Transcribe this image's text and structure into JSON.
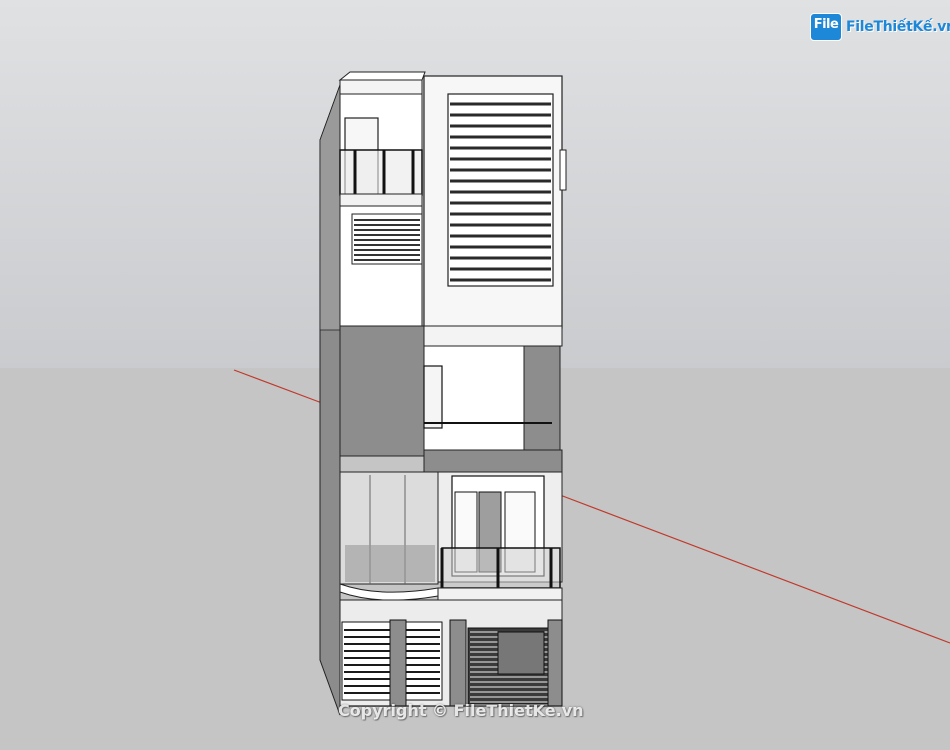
{
  "branding": {
    "logo_text": "FileThiếtKế.vn",
    "logo_badge": "File",
    "logo_icon": "file-box-icon",
    "accent_color": "#1e88d8"
  },
  "watermark": {
    "text": "Copyright © FileThietKe.vn"
  },
  "scene": {
    "view": "3D perspective model",
    "subject": "three-storey townhouse facade",
    "sky_color": "#d8dadc",
    "ground_color": "#c5c5c5",
    "axis_color": "#c0392b"
  }
}
